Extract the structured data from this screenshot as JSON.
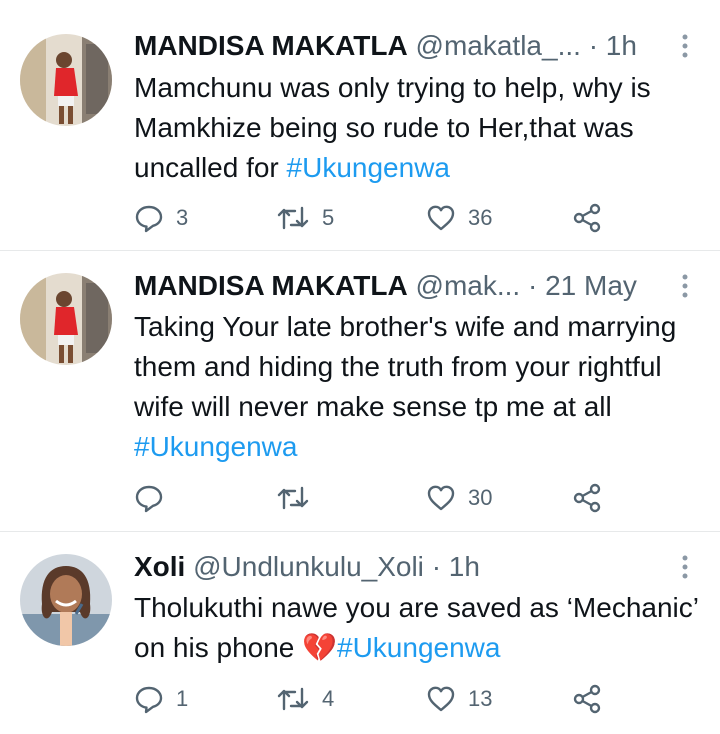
{
  "tweets": [
    {
      "name": "MANDISA MAKATLA",
      "handle": "@makatla_...",
      "separator": "·",
      "time": "1h",
      "text": "Mamchunu was only trying to help, why is Mamkhize being  so rude to Her,that was uncalled  for ",
      "hashtag": "#Ukungenwa",
      "replies": "3",
      "retweets": "5",
      "likes": "36"
    },
    {
      "name": "MANDISA MAKATLA",
      "handle": "@mak...",
      "separator": "·",
      "time": "21 May",
      "text": "Taking Your late brother's  wife and marrying them and hiding the truth from your  rightful  wife will never make sense tp me at all ",
      "hashtag": "#Ukungenwa",
      "replies": "",
      "retweets": "",
      "likes": "30"
    },
    {
      "name": "Xoli",
      "handle": "@Undlunkulu_Xoli",
      "separator": "·",
      "time": "1h",
      "text": "Tholukuthi nawe you are saved as ‘Mechanic’ on his phone ",
      "emoji": "💔",
      "hashtag": "#Ukungenwa",
      "replies": "1",
      "retweets": "4",
      "likes": "13"
    }
  ],
  "icons": {
    "reply": "reply-icon",
    "retweet": "retweet-icon",
    "like": "heart-icon",
    "share": "share-icon",
    "more": "more-vertical-icon"
  },
  "colors": {
    "hashtag": "#1d9bf0",
    "secondary_text": "#536471",
    "divider": "#e7e9ea"
  }
}
